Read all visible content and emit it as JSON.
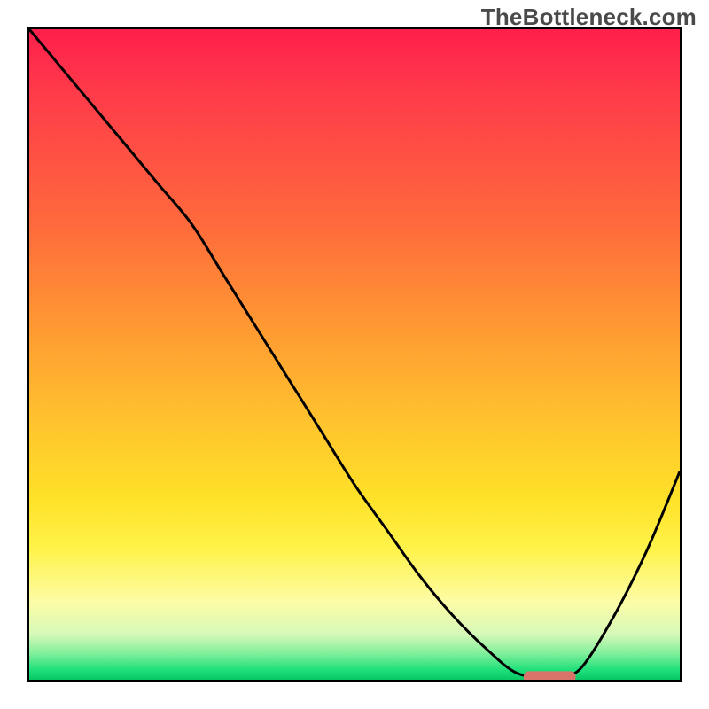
{
  "watermark": "TheBottleneck.com",
  "colors": {
    "frame": "#000000",
    "curve": "#000000",
    "marker_fill": "#d9746b",
    "gradient_top": "#ff1f4c",
    "gradient_bottom": "#07c765"
  },
  "chart_data": {
    "type": "line",
    "title": "",
    "xlabel": "",
    "ylabel": "",
    "xlim": [
      0,
      100
    ],
    "ylim": [
      0,
      100
    ],
    "grid": false,
    "legend": false,
    "x": [
      0,
      5,
      10,
      15,
      20,
      25,
      30,
      35,
      40,
      45,
      50,
      55,
      60,
      65,
      70,
      75,
      80,
      82,
      85,
      90,
      95,
      100
    ],
    "series": [
      {
        "name": "bottleneck-curve",
        "values": [
          100,
          94,
          88,
          82,
          76,
          70,
          62,
          54,
          46,
          38,
          30,
          23,
          16,
          10,
          5,
          1,
          0.5,
          0.5,
          2,
          10,
          20,
          32
        ]
      }
    ],
    "marker": {
      "name": "highlight-bar",
      "x_start": 76,
      "x_end": 84,
      "y": 0.5,
      "color": "#d9746b"
    }
  }
}
